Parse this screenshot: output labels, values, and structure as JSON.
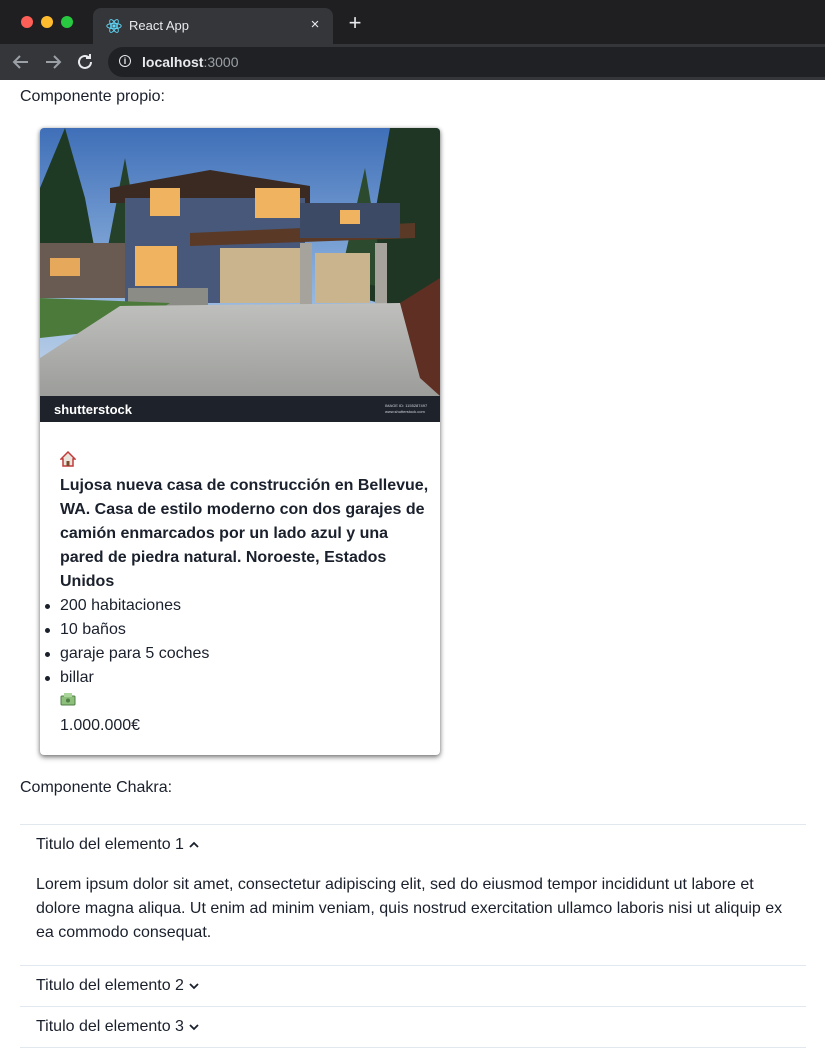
{
  "browser": {
    "tab_title": "React App",
    "tab_close": "×",
    "new_tab": "+",
    "url_host": "localhost",
    "url_port": ":3000"
  },
  "own_component": {
    "label": "Componente propio:",
    "card": {
      "image_watermark": "shutterstock",
      "image_watermark_id": "IMAGE ID: 1155287497",
      "image_watermark_site": "www.shutterstock.com",
      "title_icon": "house-emoji",
      "title": "Lujosa nueva casa de construcción en Bellevue, WA. Casa de estilo moderno con dos garajes de camión enmarcados por un lado azul y una pared de piedra natural. Noroeste, Estados Unidos",
      "features": [
        "200 habitaciones",
        "10 baños",
        "garaje para 5 coches",
        "billar"
      ],
      "price_icon": "money-emoji",
      "price": "1.000.000€"
    }
  },
  "chakra_component": {
    "label": "Componente Chakra:",
    "items": [
      {
        "title": "Titulo del elemento 1",
        "expanded": true,
        "panel": "Lorem ipsum dolor sit amet, consectetur adipiscing elit, sed do eiusmod tempor incididunt ut labore et dolore magna aliqua. Ut enim ad minim veniam, quis nostrud exercitation ullamco laboris nisi ut aliquip ex ea commodo consequat."
      },
      {
        "title": "Titulo del elemento 2",
        "expanded": false
      },
      {
        "title": "Titulo del elemento 3",
        "expanded": false
      }
    ]
  },
  "colors": {
    "chrome_bg": "#202124",
    "tab_bg": "#35363a",
    "text": "#1a202c",
    "divider": "#e2e8f0"
  }
}
